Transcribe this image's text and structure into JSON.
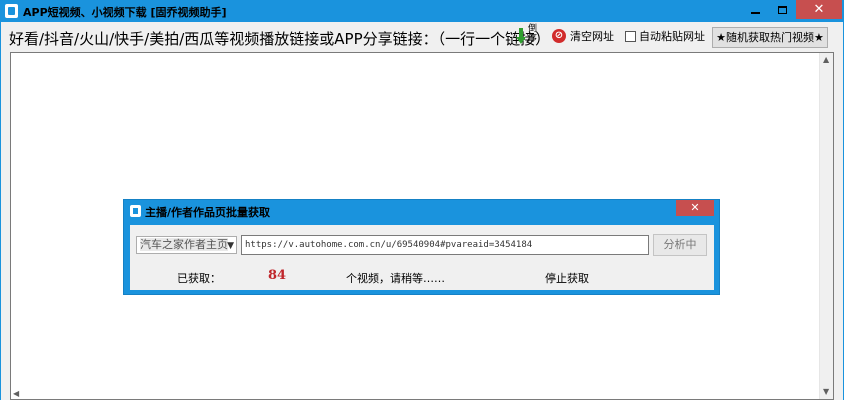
{
  "window": {
    "title": "APP短视频、小视频下载 [固乔视频助手]",
    "accent": "#1a93dd",
    "close_color": "#c74f4f"
  },
  "toolbar": {
    "prompt": "好看/抖音/火山/快手/美拍/西瓜等视频播放链接或APP分享链接：（一行一个链接）",
    "download_label": "倒序",
    "clear_label": "清空网址",
    "auto_paste_label": "自动粘贴网址",
    "random_label": "★随机获取热门视频★"
  },
  "dialog": {
    "title": "主播/作者作品页批量获取",
    "source_select": "汽车之家作者主页",
    "url": "https://v.autohome.com.cn/u/69540904#pvareaid=3454184",
    "analyze_label": "分析中",
    "got_label": "已获取：",
    "got_count": "84",
    "unit_label": "个视频，请稍等……",
    "stop_label": "停止获取",
    "count_color": "#c0262b"
  }
}
